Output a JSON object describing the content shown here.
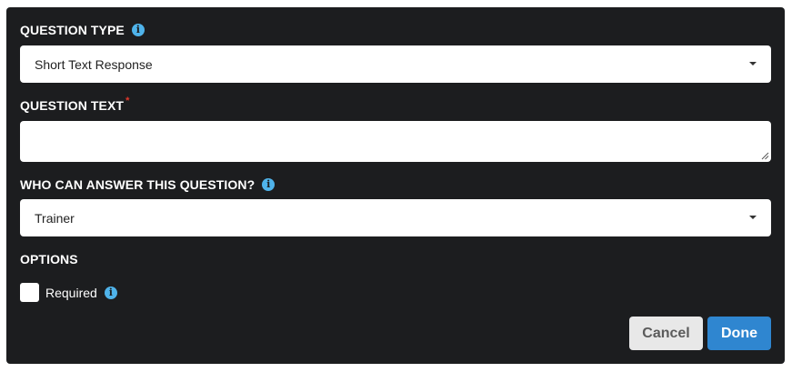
{
  "question_type": {
    "label": "QUESTION TYPE",
    "info_icon": "info-icon",
    "selected": "Short Text Response"
  },
  "question_text": {
    "label": "QUESTION TEXT",
    "required_marker": "*",
    "value": ""
  },
  "who_can_answer": {
    "label": "WHO CAN ANSWER THIS QUESTION?",
    "info_icon": "info-icon",
    "selected": "Trainer"
  },
  "options": {
    "label": "OPTIONS",
    "required_checkbox": {
      "label": "Required",
      "checked": false,
      "info_icon": "info-icon"
    }
  },
  "buttons": {
    "cancel": "Cancel",
    "done": "Done"
  },
  "colors": {
    "panel_bg": "#1c1d1f",
    "info_icon": "#4fb3ea",
    "required_star": "#e0382b",
    "done_button": "#2f86d0",
    "cancel_button": "#e8e8e8"
  }
}
